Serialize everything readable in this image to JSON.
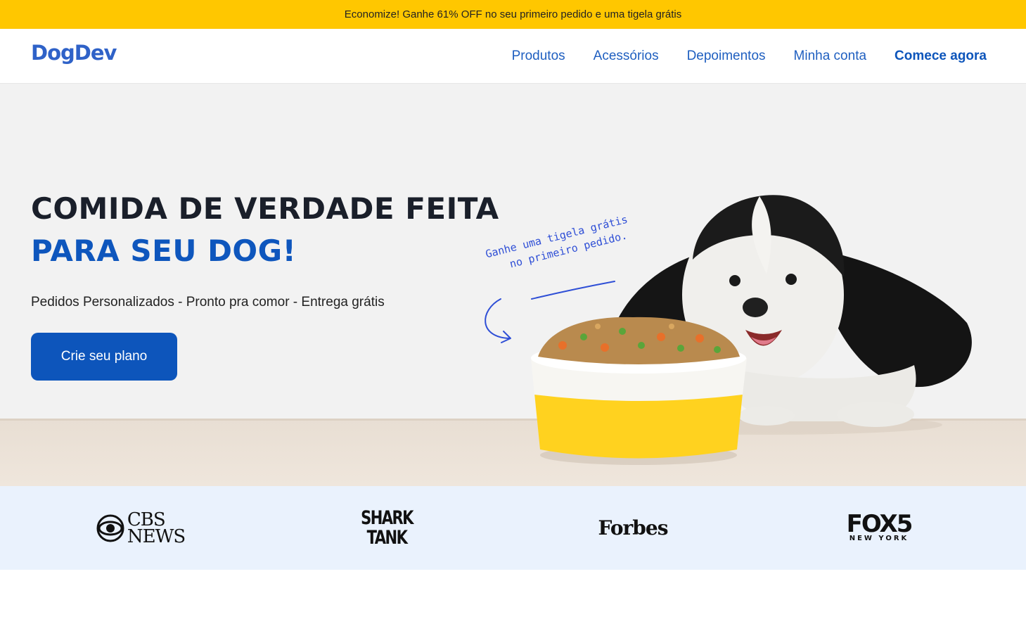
{
  "promo": {
    "text": "Economize! Ganhe 61% OFF no seu primeiro pedido e uma tigela grátis"
  },
  "header": {
    "logo": "DogDev",
    "nav": [
      {
        "label": "Produtos"
      },
      {
        "label": "Acessórios"
      },
      {
        "label": "Depoimentos"
      },
      {
        "label": "Minha conta"
      },
      {
        "label": "Comece agora"
      }
    ]
  },
  "hero": {
    "headline_1": "COMIDA DE VERDADE FEITA",
    "headline_2": "PARA SEU DOG!",
    "subtitle": "Pedidos Personalizados - Pronto pra comor - Entrega grátis",
    "cta": "Crie seu plano",
    "note_1": "Ganhe uma tigela grátis",
    "note_2": "no primeiro pedido."
  },
  "press": {
    "cbs": "CBS NEWS",
    "cbs_line1": "CBS",
    "cbs_line2": "NEWS",
    "shark_1": "SHARK",
    "shark_2": "TANK",
    "forbes": "Forbes",
    "fox_1": "FOX5",
    "fox_2": "NEW YORK"
  },
  "colors": {
    "promo_bg": "#ffc700",
    "brand_blue": "#0d55bb",
    "logo_blue": "#2f62c8",
    "hero_bg": "#f2f2f2",
    "press_bg": "#eaf2fd",
    "bowl_yellow": "#ffd21f"
  }
}
